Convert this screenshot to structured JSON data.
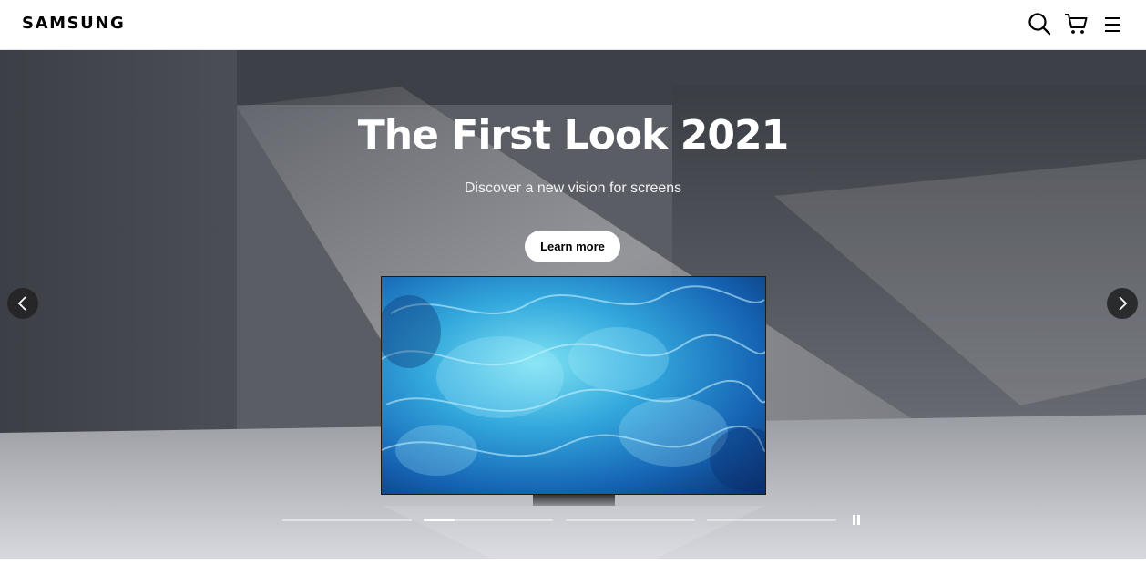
{
  "header": {
    "logo": "SAMSUNG",
    "icons": [
      "search-icon",
      "cart-icon",
      "menu-icon"
    ]
  },
  "hero": {
    "title": "The First Look 2021",
    "subtitle": "Discover a new vision for screens",
    "cta_label": "Learn more",
    "carousel": {
      "slide_count": 4,
      "active_slide": 2,
      "active_progress": 0.24,
      "controls": [
        "chevron-left-icon",
        "chevron-right-icon",
        "pause-icon"
      ]
    }
  },
  "colors": {
    "brand": "#000000",
    "hero_text": "#ffffff",
    "cta_background": "#ffffff"
  }
}
